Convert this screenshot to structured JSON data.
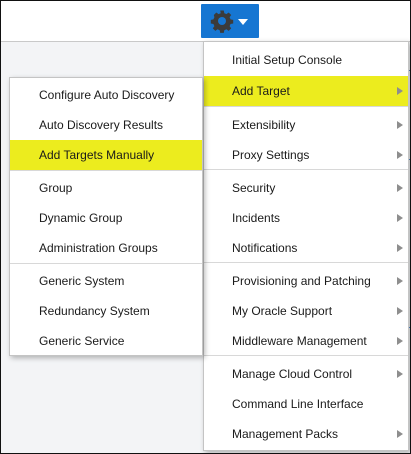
{
  "toolbar": {
    "settings_icon": "gear-icon",
    "dropdown_icon": "caret-down-icon",
    "button_color": "#1676d2"
  },
  "highlight_color": "#ecec1e",
  "main_menu": {
    "items": [
      {
        "label": "Initial Setup Console",
        "has_submenu": false
      },
      {
        "label": "Add Target",
        "has_submenu": true,
        "highlighted": true
      },
      {
        "label": "Extensibility",
        "has_submenu": true
      },
      {
        "label": "Proxy Settings",
        "has_submenu": true
      },
      {
        "label": "Security",
        "has_submenu": true
      },
      {
        "label": "Incidents",
        "has_submenu": true
      },
      {
        "label": "Notifications",
        "has_submenu": true
      },
      {
        "label": "Provisioning and Patching",
        "has_submenu": true
      },
      {
        "label": "My Oracle Support",
        "has_submenu": true
      },
      {
        "label": "Middleware Management",
        "has_submenu": true
      },
      {
        "label": "Manage Cloud Control",
        "has_submenu": true
      },
      {
        "label": "Command Line Interface",
        "has_submenu": false
      },
      {
        "label": "Management Packs",
        "has_submenu": true
      }
    ]
  },
  "add_target_submenu": {
    "items": [
      {
        "label": "Configure Auto Discovery"
      },
      {
        "label": "Auto Discovery Results"
      },
      {
        "label": "Add Targets Manually",
        "highlighted": true
      },
      {
        "label": "Group"
      },
      {
        "label": "Dynamic Group"
      },
      {
        "label": "Administration Groups"
      },
      {
        "label": "Generic System"
      },
      {
        "label": "Redundancy System"
      },
      {
        "label": "Generic Service"
      }
    ]
  }
}
